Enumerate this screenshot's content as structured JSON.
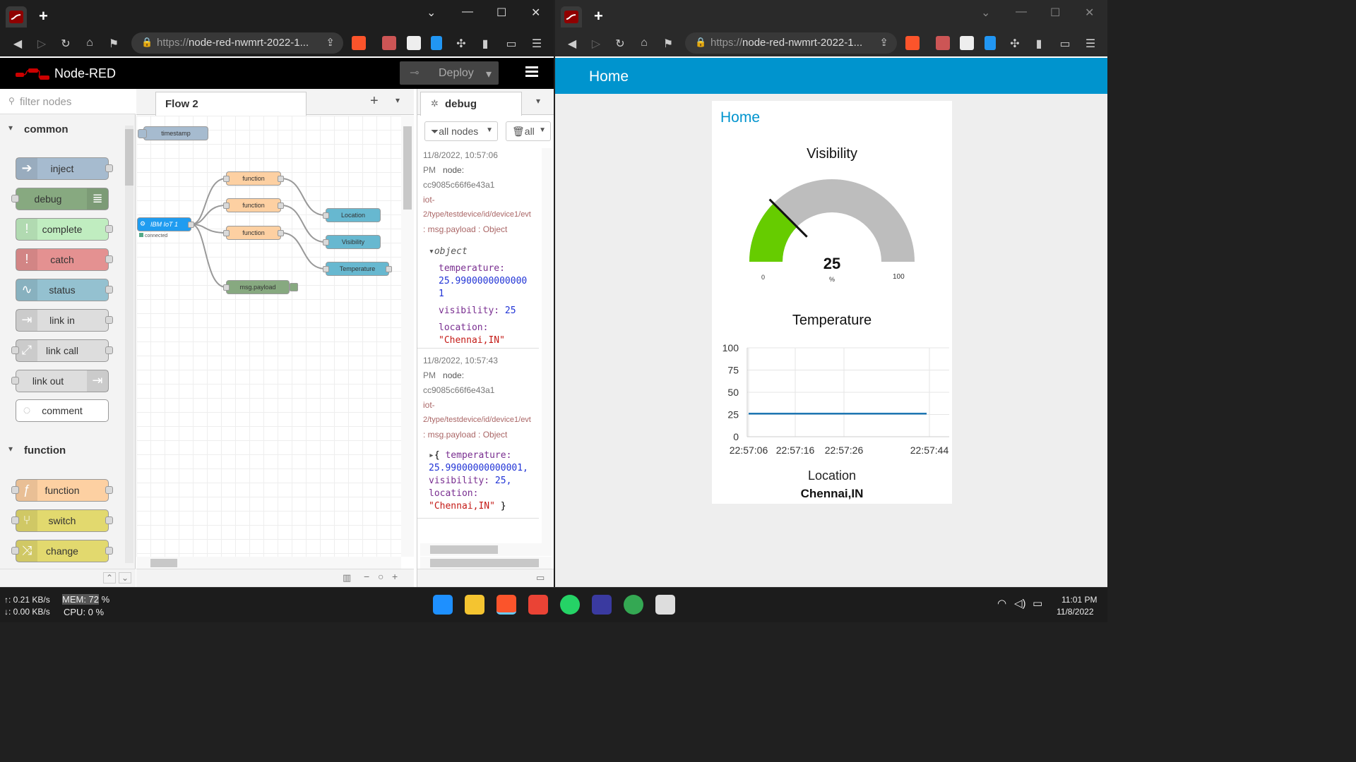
{
  "browser": {
    "url": "https://node-red-nwmrt-2022-1...",
    "url_prefix": "https://",
    "url_host": "node-red-nwmrt-2022-1...",
    "new_tab": "+"
  },
  "nodered": {
    "brand": "Node-RED",
    "deploy_label": "Deploy",
    "filter_placeholder": "filter nodes",
    "categories": [
      "common",
      "function"
    ],
    "palette_common": [
      "inject",
      "debug",
      "complete",
      "catch",
      "status",
      "link in",
      "link call",
      "link out",
      "comment"
    ],
    "palette_function": [
      "function",
      "switch",
      "change"
    ],
    "flow_tab": "Flow 2",
    "flow_nodes": {
      "timestamp": "timestamp",
      "ibm": "IBM IoT 1",
      "connected": "connected",
      "f1": "function",
      "f2": "function",
      "f3": "function",
      "location": "Location",
      "visibility": "Visibility",
      "temperature": "Temperature",
      "payload": "msg.payload"
    },
    "sidebar_tab": "debug",
    "filter_all_nodes": "all nodes",
    "clear_all": "all",
    "messages": [
      {
        "time": "11/8/2022, 10:57:06",
        "ampm": "PM",
        "node_label": "node:",
        "node": "cc9085c66f6e43a1",
        "topic1": "iot-",
        "topic2": "2/type/testdevice/id/device1/evt",
        "type": ": msg.payload : Object"
      },
      {
        "time": "11/8/2022, 10:57:43",
        "ampm": "PM",
        "node_label": "node:",
        "node": "cc9085c66f6e43a1",
        "topic1": "iot-",
        "topic2": "2/type/testdevice/id/device1/evt",
        "type": ": msg.payload : Object"
      }
    ],
    "obj1": {
      "label": "object",
      "k1": "temperature:",
      "v1a": "25.9900000000000",
      "v1b": "1",
      "k2": "visibility:",
      "v2": "25",
      "k3": "location:",
      "v3": "\"Chennai,IN\""
    },
    "obj2": {
      "l1": "{",
      "k1": "temperature:",
      "v1": "25.99000000000001,",
      "k2": "visibility:",
      "v2": "25,",
      "k3": "location:",
      "v3": "\"Chennai,IN\"",
      "close": " }"
    }
  },
  "dashboard": {
    "header": "Home",
    "group": "Home",
    "gauge": {
      "title": "Visibility",
      "value": "25",
      "unit": "%",
      "min": "0",
      "max": "100",
      "fraction": 0.25,
      "color": "#66cc00",
      "bg": "#bdbdbd"
    },
    "chart_data": {
      "type": "line",
      "title": "Temperature",
      "x": [
        "22:57:06",
        "22:57:16",
        "22:57:26",
        "22:57:44"
      ],
      "yticks": [
        "100",
        "75",
        "50",
        "25",
        "0"
      ],
      "series": [
        {
          "values": [
            25.99,
            25.99,
            25.99,
            25.99
          ]
        }
      ],
      "ylim": [
        0,
        100
      ]
    },
    "location_label": "Location",
    "location_value": "Chennai,IN"
  },
  "taskbar": {
    "up": "↑: 0.21 KB/s",
    "down": "↓: 0.00 KB/s",
    "mem_label": "MEM: 72",
    "mem_pct": " %",
    "cpu": "CPU: 0 %",
    "time": "11:01 PM",
    "date": "11/8/2022"
  }
}
